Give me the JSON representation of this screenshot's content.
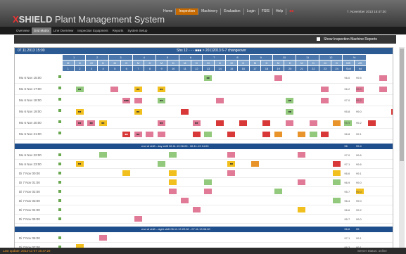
{
  "app": {
    "brand_mark": "X",
    "brand_name": "SHIELD",
    "brand_sub": "Plant Management System"
  },
  "topnav": [
    "Home",
    "Inspection",
    "Machinery",
    "Evaluation",
    "Login",
    "FSIS",
    "Help",
    "■■"
  ],
  "topnav_active": 1,
  "datetime": "7. November 2013 15:47:30",
  "subnav": [
    "Overview",
    "Grid Matrix",
    "Line Overview",
    "Inspection Equipment",
    "Reports",
    "System Setup"
  ],
  "subnav_active": 1,
  "header_buttons": {
    "b1": "1 2",
    "b2": "1 2"
  },
  "filter": {
    "label": "Show Inspection Machine Reports"
  },
  "grid": {
    "title_left": "07.11.2013 15:00",
    "title_center": "Shs 12 - - - ■■■ > 20112013 6-7 changeover",
    "groups": [
      "1",
      "2",
      "3",
      "4",
      "5",
      "6",
      "7",
      "8",
      "9",
      "10",
      "11",
      "12",
      "%"
    ],
    "subheads": [
      "M",
      "D",
      "M",
      "D",
      "M",
      "D",
      "M",
      "D",
      "M",
      "D",
      "M",
      "D",
      "M",
      "D",
      "M",
      "D",
      "M",
      "D",
      "M",
      "D",
      "M",
      "D",
      "M",
      "D",
      "MS",
      "AS"
    ],
    "numheads": [
      "1",
      "2",
      "3",
      "4",
      "5",
      "6",
      "7",
      "8",
      "9",
      "10",
      "11",
      "12",
      "13",
      "14",
      "15",
      "16",
      "17",
      "18",
      "19",
      "20",
      "21",
      "22",
      "23",
      "24",
      "Soll",
      "Ist"
    ]
  },
  "rows": [
    {
      "label": "Mo 6 Nov 15:00",
      "pct": [
        "96.0",
        "99.5"
      ],
      "cells": [
        [
          12,
          "green",
          "■■"
        ],
        [
          18,
          "pink",
          ""
        ],
        [
          27,
          "pink",
          ""
        ],
        [
          30,
          "yellow",
          ""
        ]
      ]
    },
    {
      "label": "Mo 6 Nov 17:00",
      "pct": [
        "96.2",
        "99.0"
      ],
      "cells": [
        [
          1,
          "green",
          "■■"
        ],
        [
          4,
          "pink",
          ""
        ],
        [
          6,
          "yellow",
          "■■"
        ],
        [
          8,
          "yellow",
          "■■"
        ],
        [
          22,
          "pink",
          ""
        ],
        [
          25,
          "pink",
          ""
        ],
        [
          27,
          "pink",
          ""
        ]
      ]
    },
    {
      "label": "Mo 6 Nov 18:00",
      "pct": [
        "97.0",
        "99.2"
      ],
      "cells": [
        [
          5,
          "pink",
          "■■■"
        ],
        [
          6,
          "pink",
          ""
        ],
        [
          8,
          "green",
          "■■"
        ],
        [
          13,
          "pink",
          ""
        ],
        [
          19,
          "green",
          "■■"
        ],
        [
          22,
          "pink",
          ""
        ],
        [
          25,
          "pink",
          ""
        ]
      ]
    },
    {
      "label": "Mo 6 Nov 19:00",
      "pct": [
        "95.8",
        "99.0"
      ],
      "cells": [
        [
          1,
          "yellow",
          "■■"
        ],
        [
          6,
          "yellow",
          "■■"
        ],
        [
          10,
          "red",
          ""
        ],
        [
          19,
          "green",
          "■■"
        ],
        [
          28,
          "red",
          ""
        ]
      ]
    },
    {
      "label": "Mo 6 Nov 20:00",
      "pct": [
        "95.9",
        "99.2"
      ],
      "cells": [
        [
          1,
          "pink",
          "■■"
        ],
        [
          2,
          "pink",
          "■■"
        ],
        [
          3,
          "yellow",
          "■■"
        ],
        [
          8,
          "pink",
          "■■"
        ],
        [
          11,
          "pink",
          "■■"
        ],
        [
          13,
          "red",
          ""
        ],
        [
          15,
          "red",
          ""
        ],
        [
          17,
          "red",
          ""
        ],
        [
          19,
          "pink",
          ""
        ],
        [
          21,
          "pink",
          ""
        ],
        [
          23,
          "orange",
          ""
        ],
        [
          24,
          "green",
          ""
        ],
        [
          26,
          "red",
          ""
        ]
      ]
    },
    {
      "label": "Mo 6 Nov 21:00",
      "pct": [
        "96.8",
        "99.1"
      ],
      "cells": [
        [
          5,
          "red",
          "■■"
        ],
        [
          6,
          "pink",
          "■■"
        ],
        [
          7,
          "pink",
          ""
        ],
        [
          8,
          "pink",
          ""
        ],
        [
          11,
          "red",
          ""
        ],
        [
          12,
          "green",
          ""
        ],
        [
          14,
          "red",
          ""
        ],
        [
          17,
          "red",
          ""
        ],
        [
          18,
          "orange",
          ""
        ],
        [
          20,
          "orange",
          ""
        ],
        [
          21,
          "green",
          ""
        ],
        [
          22,
          "red",
          ""
        ]
      ]
    }
  ],
  "shift1": {
    "text": "end of shift - day shift 06.11.13 06:00 - 06.11.13 14:00",
    "pct": [
      "96",
      "99.4"
    ]
  },
  "rows2": [
    {
      "label": "Mo 6 Nov 22:00",
      "pct": [
        "97.0",
        "99.6"
      ],
      "cells": [
        [
          3,
          "green",
          ""
        ],
        [
          9,
          "green",
          ""
        ],
        [
          14,
          "pink",
          ""
        ],
        [
          20,
          "pink",
          ""
        ]
      ]
    },
    {
      "label": "Mo 6 Nov 23:00",
      "pct": [
        "97.1",
        "99.6"
      ],
      "cells": [
        [
          1,
          "yellow",
          "■■"
        ],
        [
          8,
          "green",
          ""
        ],
        [
          14,
          "yellow",
          "■■"
        ],
        [
          16,
          "orange",
          ""
        ],
        [
          23,
          "red",
          ""
        ]
      ]
    },
    {
      "label": "Di 7 Nov 00:00",
      "pct": [
        "96.6",
        "99.1"
      ],
      "cells": [
        [
          5,
          "yellow",
          ""
        ],
        [
          9,
          "yellow",
          ""
        ],
        [
          14,
          "pink",
          ""
        ],
        [
          23,
          "yellow",
          ""
        ]
      ]
    },
    {
      "label": "Di 7 Nov 01:00",
      "pct": [
        "96.9",
        "99.0"
      ],
      "cells": [
        [
          9,
          "yellow",
          ""
        ],
        [
          12,
          "green",
          ""
        ],
        [
          20,
          "pink",
          ""
        ],
        [
          23,
          "green",
          ""
        ]
      ]
    },
    {
      "label": "Di 7 Nov 02:00",
      "pct": [
        "95.7",
        "99.0"
      ],
      "cells": [
        [
          9,
          "pink",
          ""
        ],
        [
          12,
          "pink",
          ""
        ],
        [
          18,
          "green",
          ""
        ],
        [
          25,
          "yellow",
          ""
        ]
      ]
    },
    {
      "label": "Di 7 Nov 03:00",
      "pct": [
        "96.4",
        "99.0"
      ],
      "cells": [
        [
          10,
          "pink",
          ""
        ],
        [
          23,
          "green",
          ""
        ]
      ]
    },
    {
      "label": "Di 7 Nov 04:00",
      "pct": [
        "96.6",
        "99.2"
      ],
      "cells": [
        [
          11,
          "pink",
          ""
        ],
        [
          20,
          "yellow",
          ""
        ]
      ]
    },
    {
      "label": "Di 7 Nov 05:00",
      "pct": [
        "95.7",
        "99.0"
      ],
      "cells": [
        [
          6,
          "pink",
          ""
        ]
      ]
    }
  ],
  "shift2": {
    "text": "end of shift - night shift 06.11.13 22:00 - 07.11.13 06:00",
    "pct": [
      "96.6",
      "99"
    ]
  },
  "rows3": [
    {
      "label": "Di 7 Nov 06:00",
      "pct": [
        "97.1",
        "99.1"
      ],
      "cells": [
        [
          3,
          "pink",
          ""
        ]
      ]
    },
    {
      "label": "Di 7 Nov 07:00",
      "pct": [
        "96.3",
        "99.1"
      ],
      "cells": [
        [
          1,
          "yellow",
          ""
        ]
      ]
    }
  ],
  "footer": {
    "left": "Last update: 2013-11-07 15:47:29",
    "right": "Server Status: online"
  },
  "colors": {
    "accent": "#c66a00",
    "header_blue": "#2c5a93",
    "pink": "#e07a96",
    "red": "#d83838",
    "green": "#92c97c",
    "yellow": "#f2c01e"
  }
}
